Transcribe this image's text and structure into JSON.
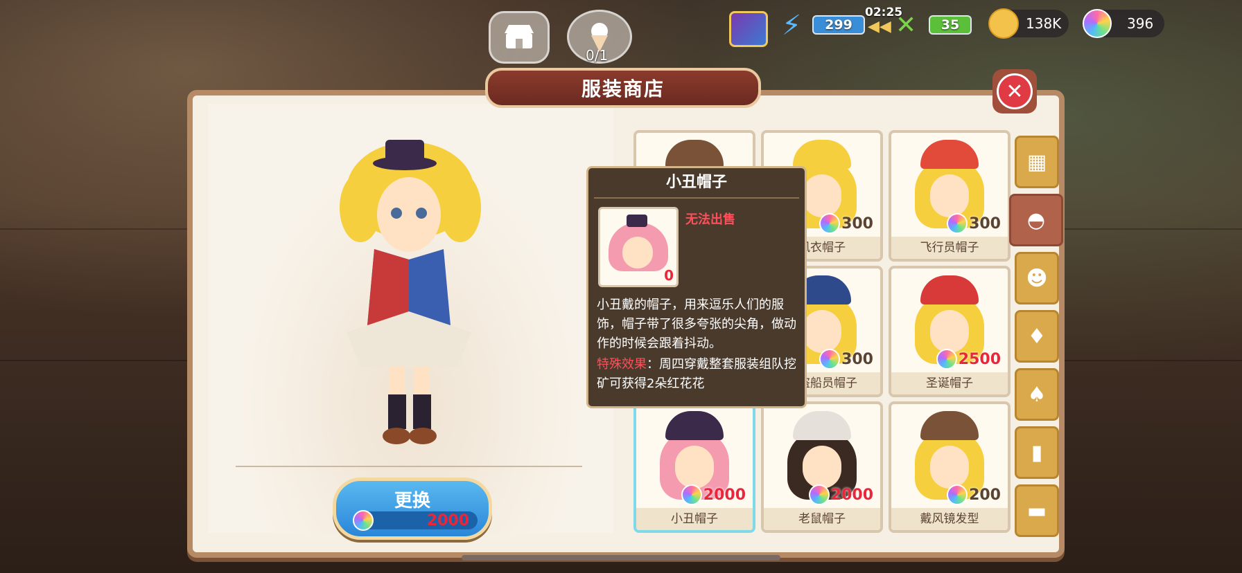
{
  "hud": {
    "energy": "299",
    "timer": "02:25",
    "food": "35",
    "coins": "138K",
    "gems": "396",
    "dessert_count": "0/1"
  },
  "shop": {
    "title": "服装商店",
    "change_button": {
      "label": "更换",
      "price": "2000"
    }
  },
  "items": [
    {
      "name": "",
      "price": "",
      "hair": "#6b4a35",
      "hat": "#7a5238"
    },
    {
      "name": "风衣帽子",
      "price": "300",
      "hair": "#f5cf3e",
      "hat": "#f5cf3e"
    },
    {
      "name": "飞行员帽子",
      "price": "300",
      "hair": "#f5cf3e",
      "hat": "#e24b3a"
    },
    {
      "name": "",
      "price": "",
      "hair": "#f5cf3e",
      "hat": "#f5cf3e"
    },
    {
      "name": "海盗船员帽子",
      "price": "300",
      "hair": "#f5cf3e",
      "hat": "#2f4a8a"
    },
    {
      "name": "圣诞帽子",
      "price": "2500",
      "price_color": "red",
      "hair": "#f5cf3e",
      "hat": "#d83a3a"
    },
    {
      "name": "小丑帽子",
      "price": "2000",
      "price_color": "red",
      "hair": "#f59bb0",
      "hat": "#3b2a4a"
    },
    {
      "name": "老鼠帽子",
      "price": "2000",
      "price_color": "red",
      "hair": "#3a2a22",
      "hat": "#e6e0da"
    },
    {
      "name": "戴风镜发型",
      "price": "200",
      "hair": "#f5cf3e",
      "hat": "#7a5238"
    }
  ],
  "tooltip": {
    "title": "小丑帽子",
    "status": "无法出售",
    "count": "0",
    "description": "小丑戴的帽子，用来逗乐人们的服饰，帽子带了很多夸张的尖角，做动作的时候会跟着抖动。",
    "effect_label": "特殊效果",
    "effect_text": "：周四穿戴整套服装组队挖矿可获得2朵红花花"
  },
  "tabs": [
    {
      "icon": "grid-icon",
      "glyph": "▦"
    },
    {
      "icon": "hat-icon",
      "glyph": "◓"
    },
    {
      "icon": "hair-icon",
      "glyph": "☻"
    },
    {
      "icon": "dress-icon",
      "glyph": "♦"
    },
    {
      "icon": "shirt-icon",
      "glyph": "♠"
    },
    {
      "icon": "pants-icon",
      "glyph": "▮"
    },
    {
      "icon": "shoes-icon",
      "glyph": "▬"
    }
  ],
  "colors": {
    "accent_red": "#e8283a",
    "panel": "#f6efe4",
    "frame": "#b58a64"
  }
}
